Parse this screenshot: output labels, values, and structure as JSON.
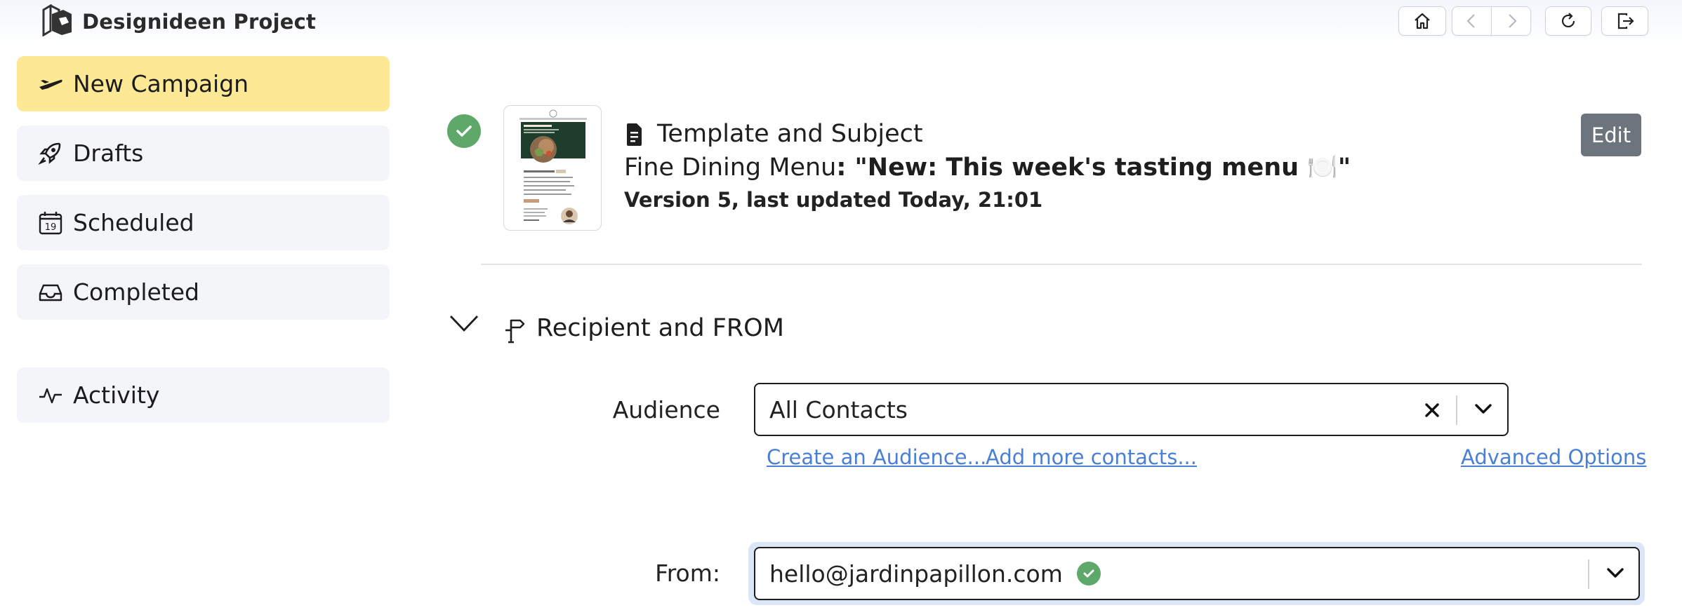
{
  "app": {
    "title": "Designideen Project"
  },
  "toolbar": {
    "buttons": [
      {
        "name": "home-button",
        "icon": "home-icon"
      },
      {
        "name": "back-button",
        "icon": "chevron-left-icon"
      },
      {
        "name": "forward-button",
        "icon": "chevron-right-icon"
      },
      {
        "name": "reload-button",
        "icon": "reload-icon"
      },
      {
        "name": "logout-button",
        "icon": "logout-icon"
      }
    ]
  },
  "sidebar": {
    "items": [
      {
        "label": "New Campaign",
        "icon": "plane-icon",
        "active": true
      },
      {
        "label": "Drafts",
        "icon": "rocket-icon"
      },
      {
        "label": "Scheduled",
        "icon": "calendar-icon",
        "icon_text": "19"
      },
      {
        "label": "Completed",
        "icon": "inbox-icon"
      },
      {
        "label": "Activity",
        "icon": "activity-icon"
      }
    ]
  },
  "template_section": {
    "title": "Template and Subject",
    "template_name": "Fine Dining Menu",
    "separator": ": ",
    "subject": "\"New: This week's tasting menu 🍽️\"",
    "version": "Version 5, last updated Today, 21:01",
    "edit_label": "Edit",
    "status": "complete",
    "thumbnail": {
      "heading": "Seasonal Tasting Menu",
      "subheading": "This week's tasting menu"
    }
  },
  "recipient_section": {
    "title": "Recipient and FROM",
    "expanded": true,
    "audience": {
      "label": "Audience",
      "value": "All Contacts",
      "links": {
        "create": "Create an Audience...",
        "add": "Add more contacts...",
        "advanced": "Advanced Options"
      }
    },
    "from": {
      "label": "From:",
      "value": "hello@jardinpapillon.com",
      "verified": true
    }
  },
  "colors": {
    "accent_active": "#fce895",
    "success": "#5ea86a",
    "link": "#4a7fd6",
    "edit_button": "#6c757d",
    "focus_ring": "#dbe6f7"
  }
}
